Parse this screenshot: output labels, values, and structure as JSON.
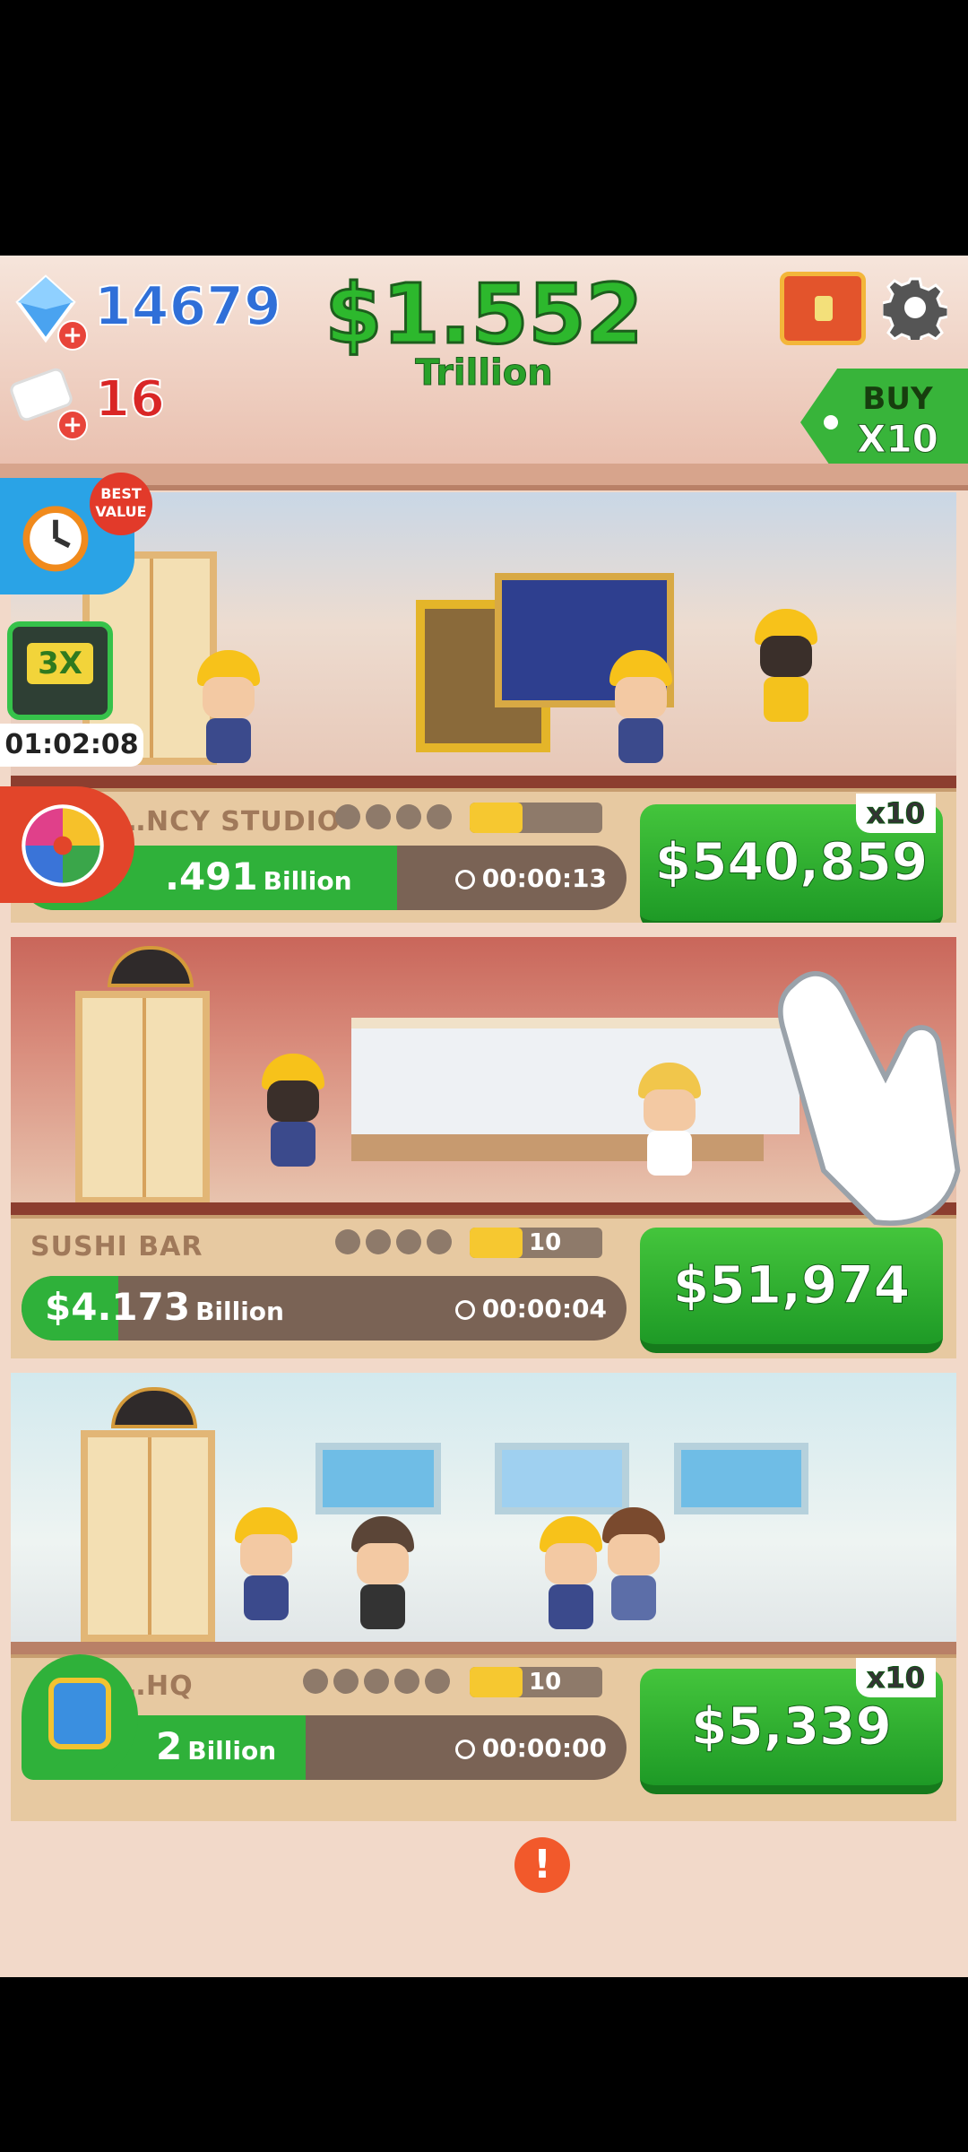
{
  "hud": {
    "gems": "14679",
    "cards": "16",
    "money": "$1.552",
    "money_unit": "Trillion",
    "buy_label": "BUY",
    "buy_multiplier": "X10"
  },
  "boosts": {
    "best_value_badge": "BEST VALUE",
    "ad_multiplier": "3X",
    "ad_timer": "01:02:08"
  },
  "floors": [
    {
      "name": "…NCY STUDIO",
      "income": ".491",
      "income_unit": "Billion",
      "timer": "00:00:13",
      "level": "",
      "progress": 0.62,
      "upgrade_cost": "$540,859",
      "multiplier": "x10"
    },
    {
      "name": "SUSHI BAR",
      "income": "$4.173",
      "income_unit": "Billion",
      "timer": "00:00:04",
      "level": "10",
      "progress": 0.16,
      "upgrade_cost": "$51,974",
      "multiplier": ""
    },
    {
      "name": "…HQ",
      "income": "2",
      "income_unit": "Billion",
      "timer": "00:00:00",
      "level": "10",
      "progress": 0.47,
      "upgrade_cost": "$5,339",
      "multiplier": "x10"
    }
  ],
  "nav": {
    "alert_badge": "!",
    "items": [
      "mail-contacts",
      "stats-board",
      "upgrade-arrow",
      "energy-boost",
      "handshake-deals"
    ]
  },
  "colors": {
    "green_button": "#2fb13a",
    "gem_blue": "#2f6fd8",
    "money_green": "#2db82d",
    "alert_orange": "#f2592b"
  }
}
